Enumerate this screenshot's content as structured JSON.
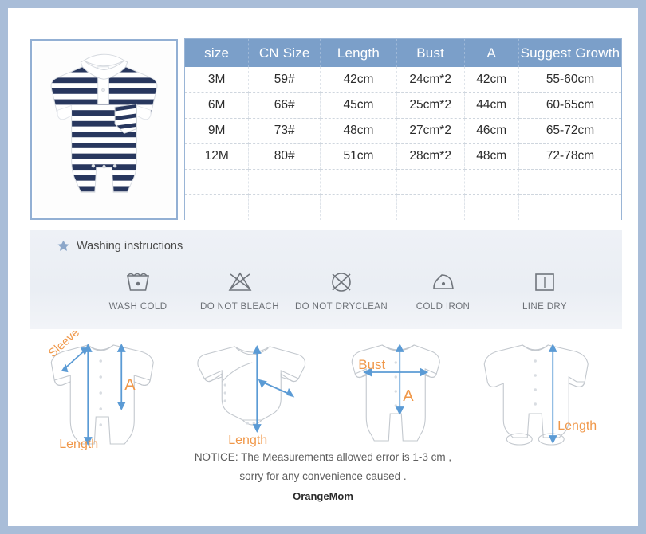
{
  "product_photo": {
    "alt": "navy and white striped short-sleeve baby polo romper",
    "stripe_color": "#28375e",
    "collar_color": "#ffffff",
    "frame_color": "#93b0d4"
  },
  "size_table": {
    "header_color": "#7b9fc9",
    "columns": [
      "size",
      "CN Size",
      "Length",
      "Bust",
      "A",
      "Suggest Growth"
    ],
    "rows": [
      {
        "size": "3M",
        "cn_size": "59#",
        "length": "42cm",
        "bust": "24cm*2",
        "a": "42cm",
        "growth": "55-60cm"
      },
      {
        "size": "6M",
        "cn_size": "66#",
        "length": "45cm",
        "bust": "25cm*2",
        "a": "44cm",
        "growth": "60-65cm"
      },
      {
        "size": "9M",
        "cn_size": "73#",
        "length": "48cm",
        "bust": "27cm*2",
        "a": "46cm",
        "growth": "65-72cm"
      },
      {
        "size": "12M",
        "cn_size": "80#",
        "length": "51cm",
        "bust": "28cm*2",
        "a": "48cm",
        "growth": "72-78cm"
      },
      {
        "size": "",
        "cn_size": "",
        "length": "",
        "bust": "",
        "a": "",
        "growth": ""
      },
      {
        "size": "",
        "cn_size": "",
        "length": "",
        "bust": "",
        "a": "",
        "growth": ""
      }
    ]
  },
  "washing": {
    "title": "Washing instructions",
    "star_icon": "star-icon",
    "star_color": "#8ba6c9",
    "background": "#eef1f6",
    "items": [
      {
        "icon": "wash-cold-icon",
        "label": "WASH COLD"
      },
      {
        "icon": "do-not-bleach-icon",
        "label": "DO NOT BLEACH"
      },
      {
        "icon": "do-not-dryclean-icon",
        "label": "DO NOT DRYCLEAN"
      },
      {
        "icon": "cold-iron-icon",
        "label": "COLD IRON"
      },
      {
        "icon": "line-dry-icon",
        "label": "LINE DRY"
      }
    ]
  },
  "diagrams": {
    "arrow_color": "#5b9bd5",
    "label_color": "#f0984a",
    "outline_color": "#c3c8ce",
    "items": [
      {
        "garment": "long-sleeve-romper",
        "labels": {
          "sleeve": "Sleeve",
          "a": "A",
          "length": "Length"
        }
      },
      {
        "garment": "long-sleeve-bodysuit",
        "labels": {
          "length": "Length"
        }
      },
      {
        "garment": "short-sleeve-romper",
        "labels": {
          "bust": "Bust",
          "a": "A"
        }
      },
      {
        "garment": "footed-sleepsuit",
        "labels": {
          "length": "Length"
        }
      }
    ]
  },
  "notice": {
    "line1": "NOTICE:   The Measurements allowed error is 1-3 cm ,",
    "line2": "sorry for any convenience caused ."
  },
  "brand": "OrangeMom"
}
